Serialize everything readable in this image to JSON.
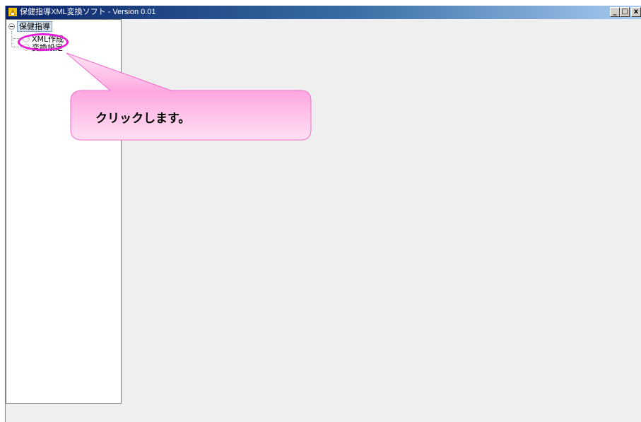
{
  "window": {
    "title": "保健指導XML変換ソフト - Version 0.01",
    "icon": "app-icon",
    "controls": {
      "minimize_label": "_",
      "maximize_label": "□",
      "close_label": "x"
    }
  },
  "tree": {
    "root": {
      "label": "保健指導",
      "expanded": true
    },
    "items": [
      {
        "label": "XML作成",
        "icon": "leaf-icon"
      },
      {
        "label": "変換設定",
        "icon": "leaf-icon"
      }
    ]
  },
  "annotation": {
    "callout_text": "クリックします。",
    "highlight_color": "#e81cd7",
    "callout_fill": "#ffb3e3"
  }
}
